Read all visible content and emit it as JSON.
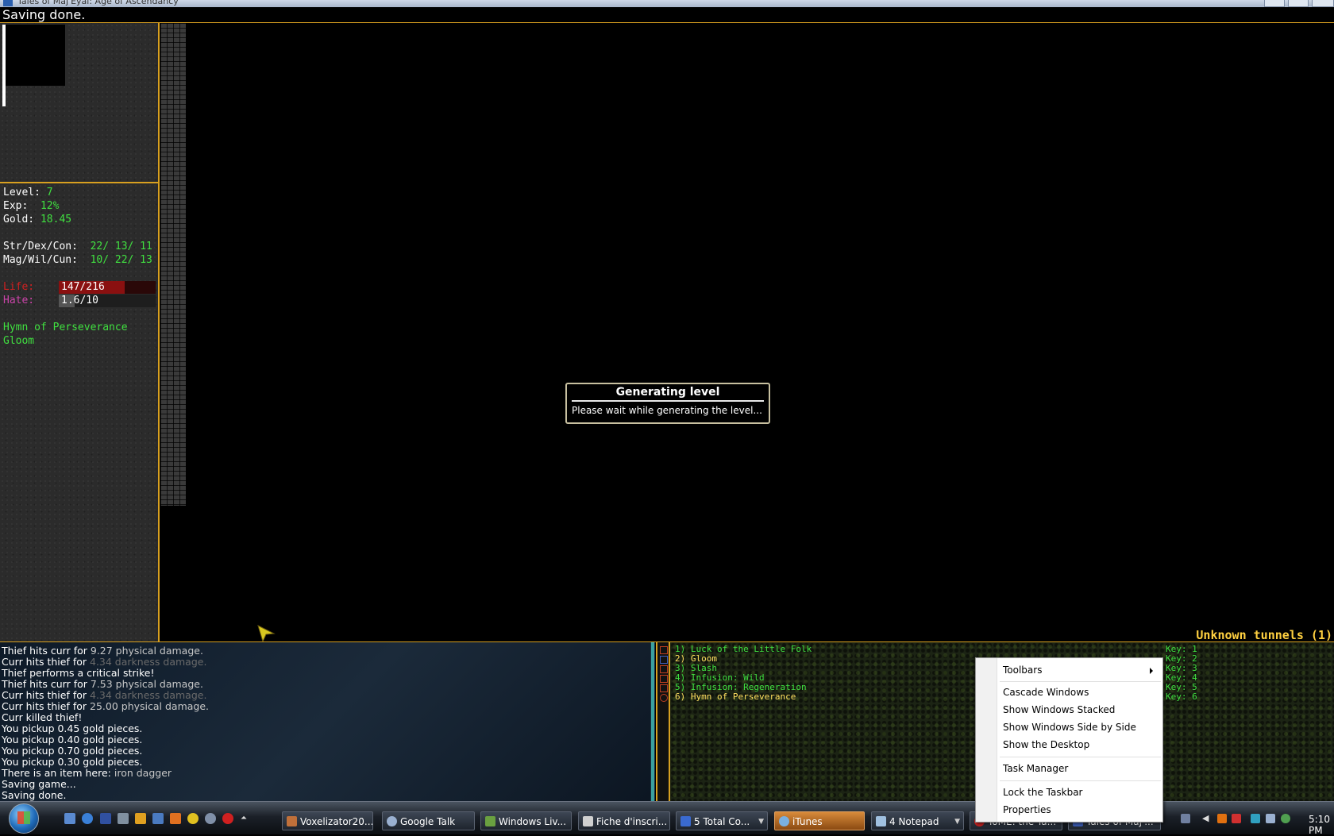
{
  "window": {
    "title": "Tales of Maj'Eyal: Age of Ascendancy"
  },
  "top_status": "Saving done.",
  "character": {
    "level_label": "Level:",
    "level": "7",
    "exp_label": "Exp:",
    "exp": "12%",
    "gold_label": "Gold:",
    "gold": "18.45",
    "sdc_label": "Str/Dex/Con:",
    "sdc": "22/ 13/ 11",
    "mwc_label": "Mag/Wil/Cun:",
    "mwc": "10/ 22/ 13",
    "life_label": "Life:",
    "life": "147/216",
    "life_fraction": 0.68,
    "hate_label": "Hate:",
    "hate": "1.6/10",
    "hate_fraction": 0.16,
    "effects": [
      "Hymn of Perseverance",
      "Gloom"
    ]
  },
  "zone": "Unknown tunnels (1)",
  "dialog": {
    "title": "Generating level",
    "message": "Please wait while generating the level..."
  },
  "log": [
    {
      "pre": "Thief hits curr for ",
      "val": "9.27 physical damage",
      "post": ".",
      "kind": "dmg"
    },
    {
      "pre": "Curr hits thief for ",
      "val": "4.34 darkness damage",
      "post": ".",
      "kind": "drk"
    },
    {
      "pre": "Thief performs a critical strike!",
      "val": "",
      "post": "",
      "kind": ""
    },
    {
      "pre": "Thief hits curr for ",
      "val": "7.53 physical damage",
      "post": ".",
      "kind": "dmg"
    },
    {
      "pre": "Curr hits thief for ",
      "val": "4.34 darkness damage",
      "post": ".",
      "kind": "drk"
    },
    {
      "pre": "Curr hits thief for ",
      "val": "25.00 physical damage",
      "post": ".",
      "kind": "dmg"
    },
    {
      "pre": "Curr killed thief!",
      "val": "",
      "post": "",
      "kind": ""
    },
    {
      "pre": "You pickup 0.45 gold pieces.",
      "val": "",
      "post": "",
      "kind": ""
    },
    {
      "pre": "You pickup 0.40 gold pieces.",
      "val": "",
      "post": "",
      "kind": ""
    },
    {
      "pre": "You pickup 0.70 gold pieces.",
      "val": "",
      "post": "",
      "kind": ""
    },
    {
      "pre": "You pickup 0.30 gold pieces.",
      "val": "",
      "post": "",
      "kind": ""
    },
    {
      "pre": "There is an item here: ",
      "val": "iron dagger",
      "post": "",
      "kind": "dmg"
    },
    {
      "pre": "Saving game...",
      "val": "",
      "post": "",
      "kind": ""
    },
    {
      "pre": "Saving done.",
      "val": "",
      "post": "",
      "kind": ""
    }
  ],
  "hotkeys": [
    {
      "label": "1) Luck of the Little Folk",
      "key": "Key: 1",
      "active": false
    },
    {
      "label": "2) Gloom",
      "key": "Key: 2",
      "active": true
    },
    {
      "label": "3) Slash",
      "key": "Key: 3",
      "active": false
    },
    {
      "label": "4) Infusion: Wild",
      "key": "Key: 4",
      "active": false
    },
    {
      "label": "5) Infusion: Regeneration",
      "key": "Key: 5",
      "active": false
    },
    {
      "label": "6) Hymn of Perseverance",
      "key": "Key: 6",
      "active": true
    }
  ],
  "context_menu": {
    "toolbars": "Toolbars",
    "cascade": "Cascade Windows",
    "stacked": "Show Windows Stacked",
    "side_by_side": "Show Windows Side by Side",
    "desktop": "Show the Desktop",
    "task_manager": "Task Manager",
    "lock": "Lock the Taskbar",
    "properties": "Properties"
  },
  "taskbar": {
    "buttons": [
      {
        "label": "Voxelizator20...",
        "color": "#c0703a"
      },
      {
        "label": "Google Talk",
        "color": "#9ab0d0"
      },
      {
        "label": "Windows Liv...",
        "color": "#6aa040"
      },
      {
        "label": "Fiche d'inscri...",
        "color": "#d0d0d0"
      },
      {
        "label": "5 Total Co...",
        "color": "#3a6ad0"
      },
      {
        "label": "iTunes",
        "color": "#7ab0e0"
      },
      {
        "label": "4 Notepad",
        "color": "#a0c0e0"
      },
      {
        "label": "ToME: the Ta...",
        "color": "#c02020"
      },
      {
        "label": "Tales of Maj'...",
        "color": "#3a5ab0"
      }
    ],
    "clock": "5:10 PM"
  },
  "colors": {
    "accent": "#d8a020",
    "text_green": "#40e040",
    "life": "#8a1010",
    "hate": "#cc44aa"
  }
}
